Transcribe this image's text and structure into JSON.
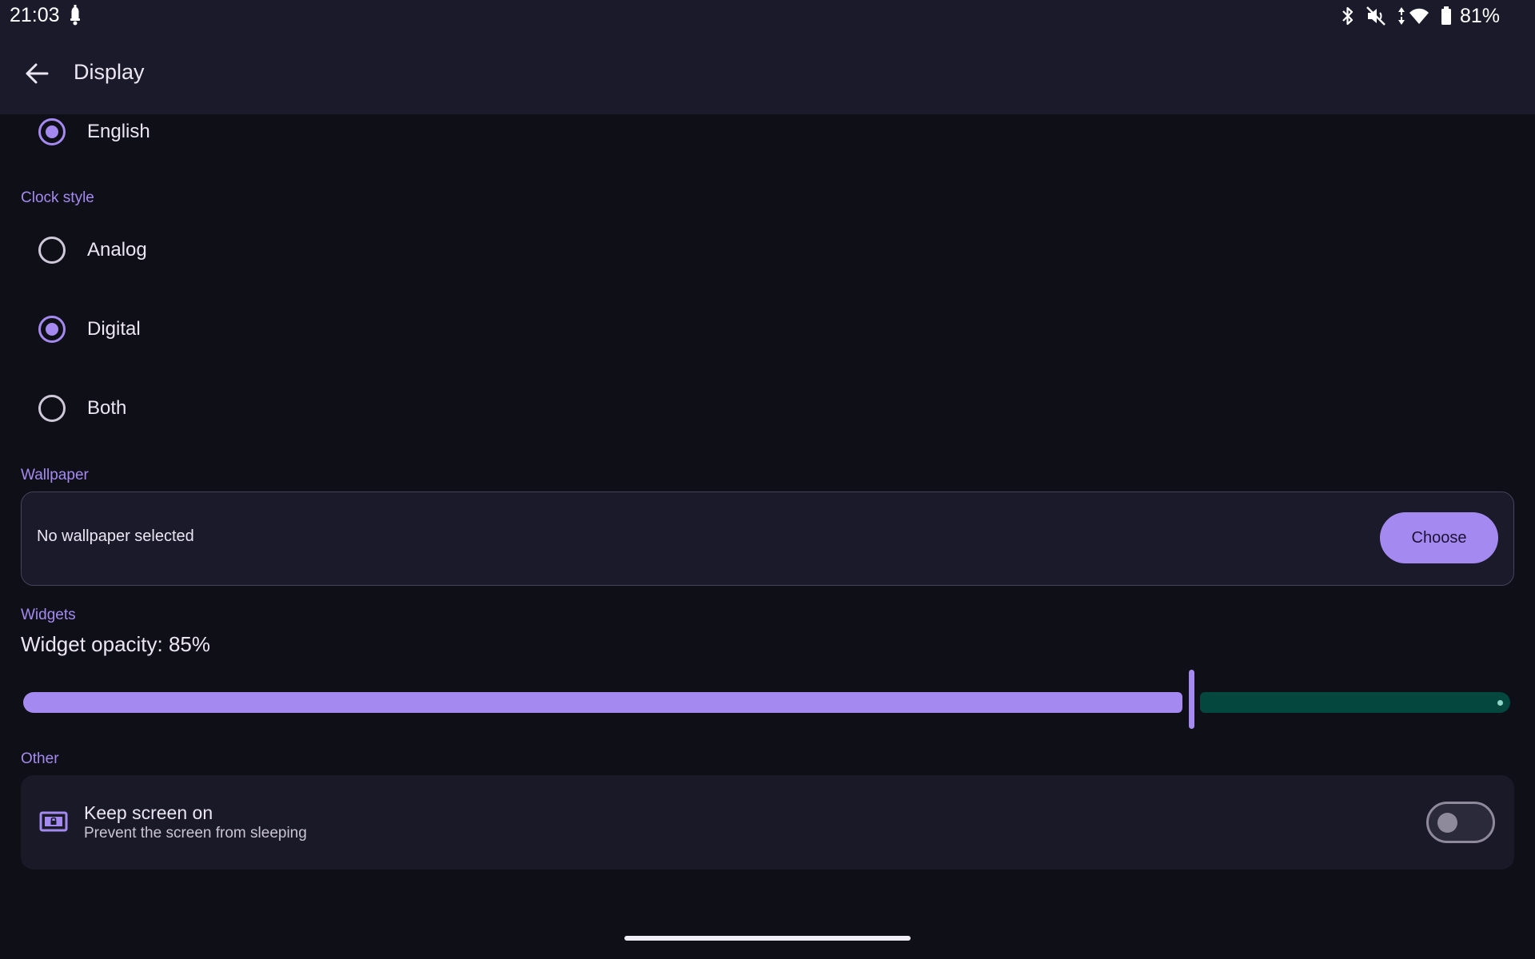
{
  "status_bar": {
    "time": "21:03",
    "battery_percent": "81%",
    "icons": [
      "notification-icon",
      "bluetooth-icon",
      "mute-icon",
      "data-arrows-icon",
      "wifi-icon",
      "battery-icon"
    ]
  },
  "app_bar": {
    "back_icon": "arrow-back-icon",
    "title": "Display"
  },
  "language": {
    "selected": "English",
    "options": [
      {
        "label": "English",
        "checked": true
      }
    ]
  },
  "clock_style": {
    "header": "Clock style",
    "options": [
      {
        "label": "Analog",
        "checked": false
      },
      {
        "label": "Digital",
        "checked": true
      },
      {
        "label": "Both",
        "checked": false
      }
    ]
  },
  "wallpaper": {
    "header": "Wallpaper",
    "status": "No wallpaper selected",
    "button_label": "Choose"
  },
  "widgets": {
    "header": "Widgets",
    "opacity_label": "Widget opacity: 85%",
    "opacity_value": 0.85
  },
  "other": {
    "header": "Other",
    "keep_screen_on": {
      "icon": "screen-lock-icon",
      "title": "Keep screen on",
      "subtitle": "Prevent the screen from sleeping",
      "enabled": false
    }
  },
  "colors": {
    "accent": "#a48af0",
    "background": "#0f0f17",
    "surface": "#1a1a2b",
    "slider_inactive": "#04473f"
  }
}
